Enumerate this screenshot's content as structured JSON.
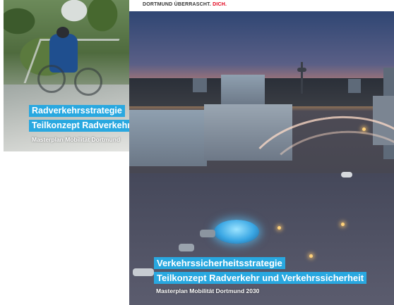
{
  "brand": {
    "prefix": "DORTMUND ÜBERRASCHT.",
    "accent": "DICH.",
    "accent_color": "#e2001a"
  },
  "back_cover": {
    "title_line1": "Radverkehrsstrategie",
    "title_line2": "Teilkonzept Radverkehr",
    "subtitle": "Masterplan Mobilität Dortmund"
  },
  "front_cover": {
    "title_line1": "Verkehrssicherheitsstrategie",
    "title_line2": "Teilkonzept Radverkehr und Verkehrssicherheit",
    "subtitle": "Masterplan Mobilität Dortmund 2030"
  },
  "colors": {
    "label_background": "#29a8e0"
  }
}
